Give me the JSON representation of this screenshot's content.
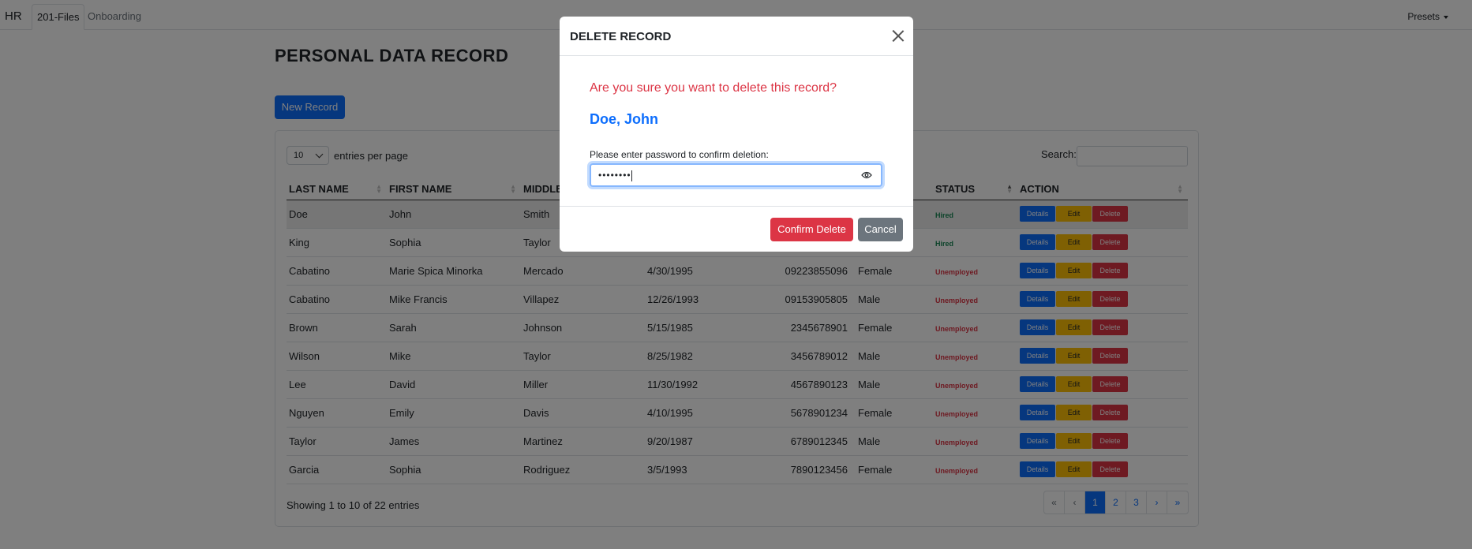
{
  "nav": {
    "brand": "HR",
    "tabs": [
      {
        "label": "201-Files",
        "active": true
      },
      {
        "label": "Onboarding",
        "active": false
      }
    ],
    "presets_label": "Presets"
  },
  "page": {
    "title": "PERSONAL DATA RECORD",
    "new_record_label": "New Record"
  },
  "table_controls": {
    "entries_value": "10",
    "entries_label": "entries per page",
    "search_label": "Search:",
    "search_value": ""
  },
  "table": {
    "columns": [
      "LAST NAME",
      "FIRST NAME",
      "MIDDLE NAME",
      "",
      "",
      "",
      "STATUS",
      "ACTION"
    ],
    "rows": [
      {
        "last": "Doe",
        "first": "John",
        "middle": "Smith",
        "birth": "",
        "contact": "",
        "gender": "",
        "status": "Hired"
      },
      {
        "last": "King",
        "first": "Sophia",
        "middle": "Taylor",
        "birth": "",
        "contact": "",
        "gender": "",
        "status": "Hired"
      },
      {
        "last": "Cabatino",
        "first": "Marie Spica Minorka",
        "middle": "Mercado",
        "birth": "4/30/1995",
        "contact": "09223855096",
        "gender": "Female",
        "status": "Unemployed"
      },
      {
        "last": "Cabatino",
        "first": "Mike Francis",
        "middle": "Villapez",
        "birth": "12/26/1993",
        "contact": "09153905805",
        "gender": "Male",
        "status": "Unemployed"
      },
      {
        "last": "Brown",
        "first": "Sarah",
        "middle": "Johnson",
        "birth": "5/15/1985",
        "contact": "2345678901",
        "gender": "Female",
        "status": "Unemployed"
      },
      {
        "last": "Wilson",
        "first": "Mike",
        "middle": "Taylor",
        "birth": "8/25/1982",
        "contact": "3456789012",
        "gender": "Male",
        "status": "Unemployed"
      },
      {
        "last": "Lee",
        "first": "David",
        "middle": "Miller",
        "birth": "11/30/1992",
        "contact": "4567890123",
        "gender": "Male",
        "status": "Unemployed"
      },
      {
        "last": "Nguyen",
        "first": "Emily",
        "middle": "Davis",
        "birth": "4/10/1995",
        "contact": "5678901234",
        "gender": "Female",
        "status": "Unemployed"
      },
      {
        "last": "Taylor",
        "first": "James",
        "middle": "Martinez",
        "birth": "9/20/1987",
        "contact": "6789012345",
        "gender": "Male",
        "status": "Unemployed"
      },
      {
        "last": "Garcia",
        "first": "Sophia",
        "middle": "Rodriguez",
        "birth": "3/5/1993",
        "contact": "7890123456",
        "gender": "Female",
        "status": "Unemployed"
      }
    ],
    "action_labels": {
      "details": "Details",
      "edit": "Edit",
      "delete": "Delete"
    }
  },
  "footer": {
    "info": "Showing 1 to 10 of 22 entries",
    "pagination": [
      "«",
      "‹",
      "1",
      "2",
      "3",
      "›",
      "»"
    ],
    "current_page": "1"
  },
  "modal": {
    "title": "DELETE RECORD",
    "question": "Are you sure you want to delete this record?",
    "record_name": "Doe, John",
    "password_label": "Please enter password to confirm deletion:",
    "password_value": "••••••••",
    "confirm_label": "Confirm Delete",
    "cancel_label": "Cancel"
  },
  "colors": {
    "primary": "#0d6efd",
    "danger": "#dc3545",
    "warning": "#ffc107",
    "secondary": "#6c757d",
    "success": "#198754"
  }
}
